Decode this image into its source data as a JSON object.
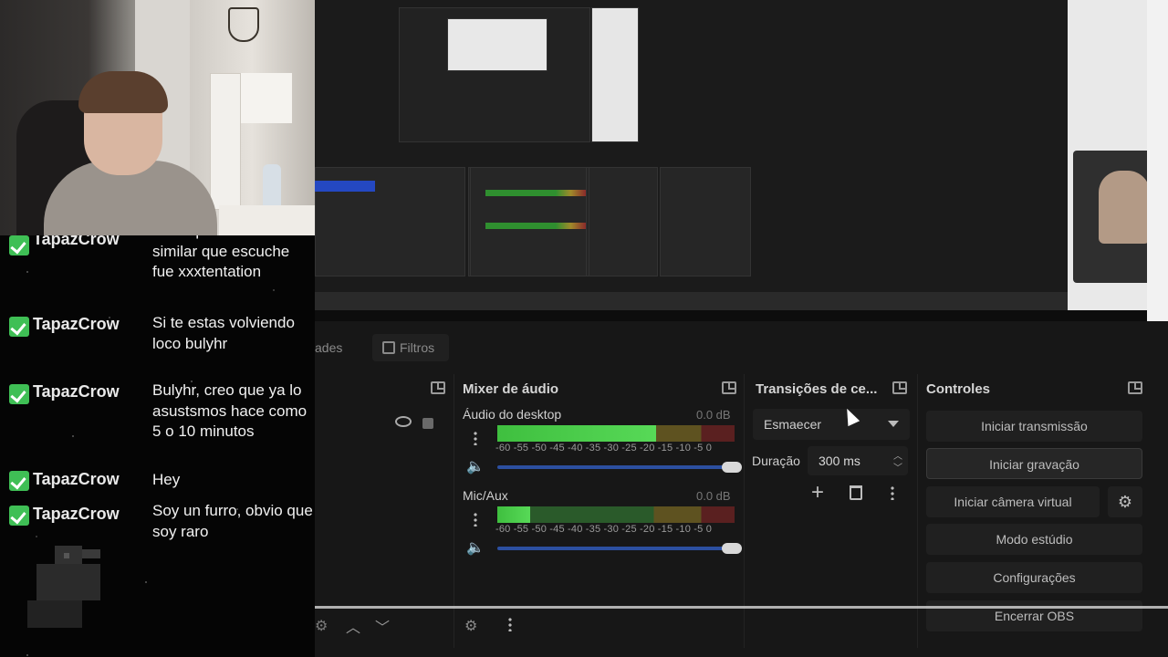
{
  "chat": {
    "messages": [
      {
        "user": "TapazCrow",
        "text": "Creo que lo más similar que escuche fue xxxtentation"
      },
      {
        "user": "TapazCrow",
        "text": "Si te estas volviendo loco bulyhr"
      },
      {
        "user": "TapazCrow",
        "text": "Bulyhr, creo que ya lo asustsmos hace como 5 o 10 minutos"
      },
      {
        "user": "TapazCrow",
        "text": "Hey"
      },
      {
        "user": "TapazCrow",
        "text": "Soy un furro, obvio que soy raro"
      }
    ]
  },
  "obs": {
    "tabs": {
      "properties": "ades",
      "filters": "Filtros"
    },
    "mixer": {
      "title": "Mixer de áudio",
      "scale": "-60 -55 -50 -45 -40 -35 -30 -25 -20 -15 -10 -5 0",
      "sources": [
        {
          "name": "Áudio do desktop",
          "db": "0.0 dB",
          "level": 0.67,
          "volume": 1.0
        },
        {
          "name": "Mic/Aux",
          "db": "0.0 dB",
          "level": 0.14,
          "volume": 1.0
        }
      ]
    },
    "transitions": {
      "title": "Transições de ce...",
      "selected": "Esmaecer",
      "duration_label": "Duração",
      "duration_value": "300 ms"
    },
    "controls": {
      "title": "Controles",
      "buttons": [
        "Iniciar transmissão",
        "Iniciar gravação",
        "Iniciar câmera virtual",
        "Modo estúdio",
        "Configurações",
        "Encerrar OBS"
      ]
    }
  },
  "colors": {
    "accent_green": "#3fbf55",
    "meter_green": "#3fbf3f",
    "volume_blue": "#2c4fa0"
  }
}
